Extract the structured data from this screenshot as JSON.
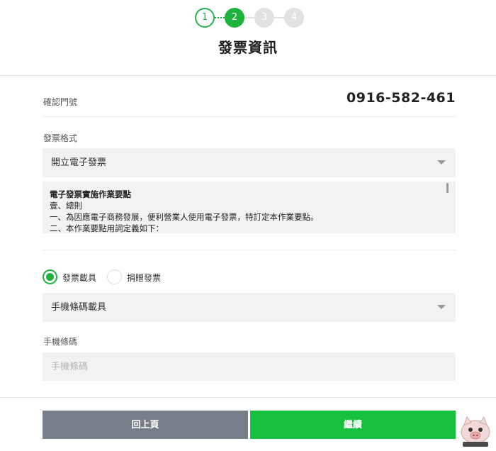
{
  "steps": [
    "1",
    "2",
    "3",
    "4"
  ],
  "page_title": "發票資訊",
  "confirm_phone": {
    "label": "確認門號",
    "value": "0916-582-461"
  },
  "invoice_format": {
    "label": "發票格式",
    "selected": "開立電子發票"
  },
  "terms": {
    "title": "電子發票實施作業要點",
    "lines": [
      "壹、總則",
      "一、為因應電子商務發展，便利營業人使用電子發票，特訂定本作業要點。",
      "二、本作業要點用詞定義如下："
    ]
  },
  "invoice_type": {
    "option1": "發票載具",
    "option2": "捐贈發票",
    "selected": "發票載具"
  },
  "carrier": {
    "selected": "手機條碼載具"
  },
  "barcode": {
    "label": "手機條碼",
    "placeholder": "手機條碼",
    "value": ""
  },
  "buttons": {
    "back": "回上頁",
    "next": "繼續"
  },
  "colors": {
    "accent": "#1fb33d",
    "back_button": "#767f8a",
    "next_button": "#17c03f"
  }
}
